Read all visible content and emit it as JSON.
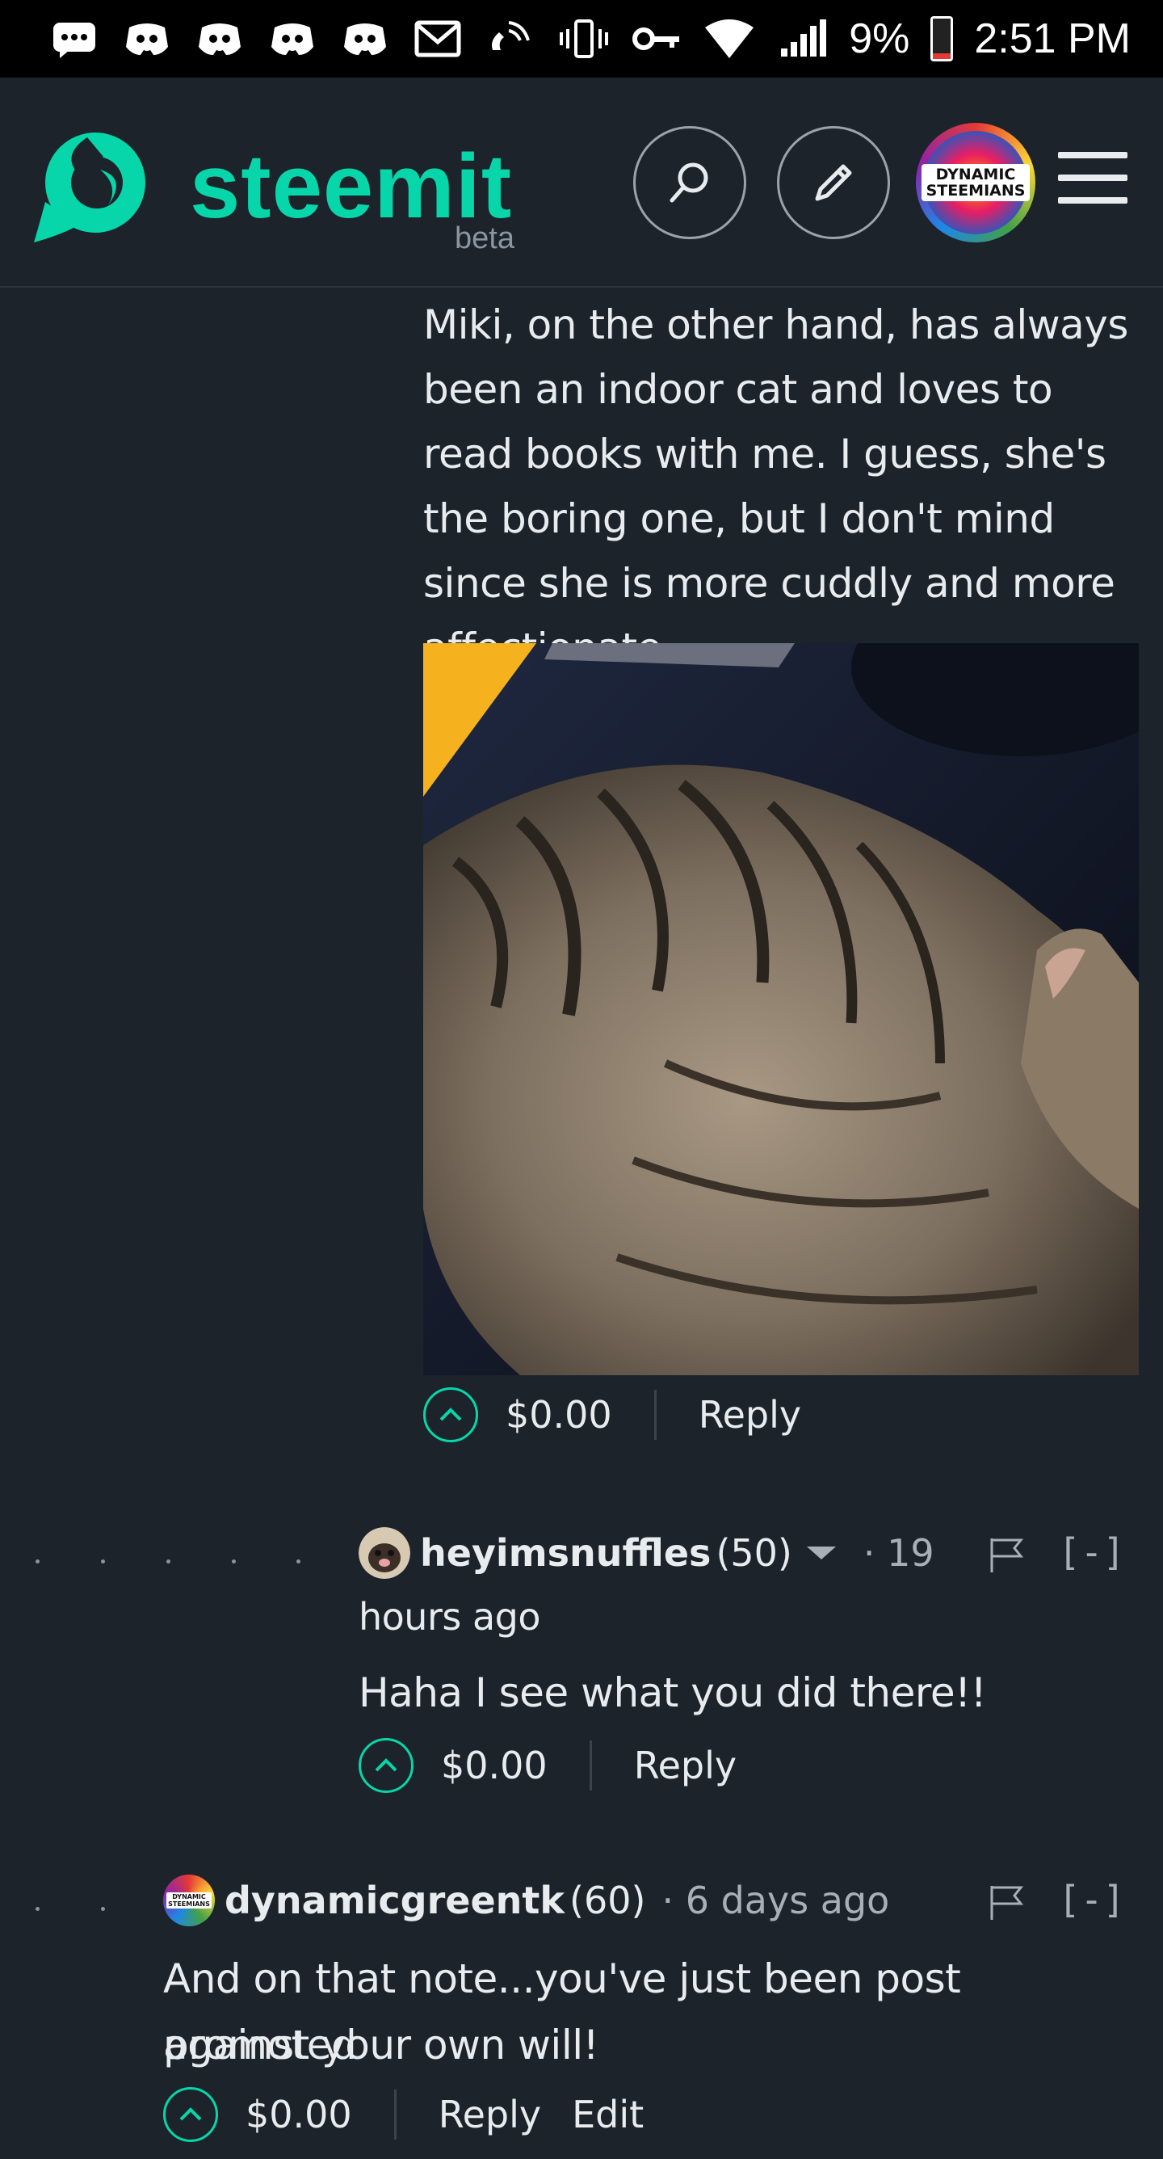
{
  "status_bar": {
    "battery_percent": "9%",
    "time": "2:51 PM",
    "left_icons": [
      "messages-icon",
      "discord-icon",
      "discord-icon",
      "discord-icon",
      "discord-icon",
      "gmail-icon",
      "wifi-call-icon"
    ],
    "right_icons": [
      "vibrate-icon",
      "vpn-key-icon",
      "wifi-icon",
      "signal-icon",
      "battery-icon"
    ]
  },
  "header": {
    "logo_text": "steemit",
    "beta_label": "beta",
    "avatar_label_line1": "DYNAMIC",
    "avatar_label_line2": "STEEMIANS",
    "colors": {
      "brand": "#06d6a9",
      "background": "#1c232b"
    }
  },
  "post": {
    "paragraph": "Miki, on the other hand, has always been an indoor cat and loves to read books with me. I guess, she's the boring one, but I don't mind since she is more cuddly and more affectionate.",
    "image_subject": "tabby cat lying on a dark desk",
    "payout": "$0.00",
    "reply_label": "Reply"
  },
  "comments": [
    {
      "author": "heyimsnuffles",
      "reputation": "(50)",
      "time_part1": "· 19",
      "time_part2": "hours ago",
      "body": "Haha I see what you did there!!",
      "payout": "$0.00",
      "reply_label": "Reply",
      "collapse_label": "[-]"
    },
    {
      "author": "dynamicgreentk",
      "reputation": "(60)",
      "time": "· 6 days ago",
      "body_line1": "And on that note...you've just been post promoted",
      "body_line2": "against your own will!",
      "payout": "$0.00",
      "reply_label": "Reply",
      "edit_label": "Edit",
      "collapse_label": "[-]",
      "avatar_label_line1": "DYNAMIC",
      "avatar_label_line2": "STEEMIANS"
    }
  ]
}
